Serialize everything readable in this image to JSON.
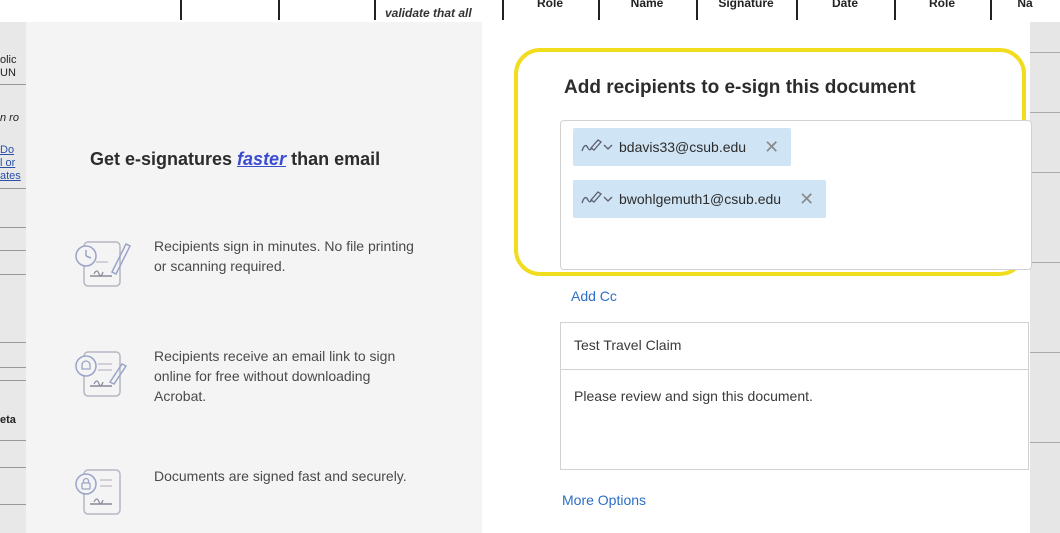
{
  "background_document": {
    "validate_text": "validate that all",
    "header_cells": [
      "Role",
      "Name",
      "Signature",
      "Date",
      "Role",
      "Na"
    ],
    "left_fragments": [
      "olic",
      "UN",
      "n ro",
      "Do",
      "l or",
      "ates",
      "eta"
    ]
  },
  "intro": {
    "headline_pre": "Get e-signatures ",
    "headline_emph": "faster",
    "headline_post": " than email",
    "features": [
      {
        "icon": "sign-in-minutes-icon",
        "text": "Recipients sign in minutes. No file printing or scanning required."
      },
      {
        "icon": "email-link-icon",
        "text": "Recipients receive an email link to sign online for free without downloading Acrobat."
      },
      {
        "icon": "secure-document-icon",
        "text": "Documents are signed fast and securely."
      }
    ]
  },
  "recipients": {
    "title": "Add recipients to e-sign this document",
    "list": [
      {
        "email": "bdavis33@csub.edu",
        "remove": "✕"
      },
      {
        "email": "bwohlgemuth1@csub.edu",
        "remove": "✕"
      }
    ],
    "add_cc": "Add Cc"
  },
  "form": {
    "subject": "Test Travel Claim",
    "message": "Please review and sign this document."
  },
  "more_options": "More Options",
  "colors": {
    "highlight": "#f2dc1e",
    "chip": "#cfe4f5",
    "link": "#2d6ec6",
    "accent_faster": "#3a4bd0"
  }
}
